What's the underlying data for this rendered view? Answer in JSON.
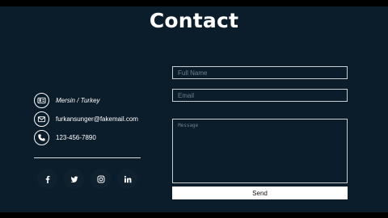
{
  "header": {
    "title": "Contact"
  },
  "contact_info": [
    {
      "icon": "address-card-icon",
      "text": "Mersin / Turkey"
    },
    {
      "icon": "envelope-icon",
      "text": "furkansunger@fakemail.com"
    },
    {
      "icon": "phone-icon",
      "text": "123-456-7890"
    }
  ],
  "social": [
    {
      "icon": "facebook-icon",
      "glyph": "f"
    },
    {
      "icon": "twitter-icon"
    },
    {
      "icon": "instagram-icon"
    },
    {
      "icon": "linkedin-icon",
      "glyph": "in"
    }
  ],
  "form": {
    "name_placeholder": "Full Name",
    "email_placeholder": "Email",
    "message_placeholder": "Message",
    "send_label": "Send"
  },
  "colors": {
    "background": "#0b1c2b",
    "border": "#c9ced3",
    "button": "#ffffff"
  }
}
